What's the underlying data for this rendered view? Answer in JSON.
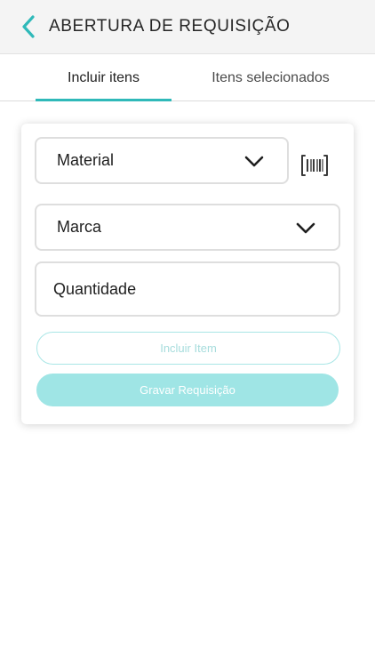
{
  "header": {
    "title": "ABERTURA DE REQUISIÇÃO",
    "back_icon": "chevron-left-icon"
  },
  "tabs": [
    {
      "label": "Incluir itens",
      "active": true
    },
    {
      "label": "Itens selecionados",
      "active": false
    }
  ],
  "form": {
    "material": {
      "value": "Material",
      "icon": "chevron-down-icon"
    },
    "marca": {
      "value": "Marca",
      "icon": "chevron-down-icon"
    },
    "quantidade": {
      "placeholder": "Quantidade"
    },
    "barcode_icon": "barcode-scan-icon",
    "include_button": "Incluir Item",
    "save_button": "Gravar Requisição"
  },
  "colors": {
    "accent": "#2fb9b9",
    "button_disabled": "#9fe5e5",
    "header_bg": "#f4f4f4"
  }
}
